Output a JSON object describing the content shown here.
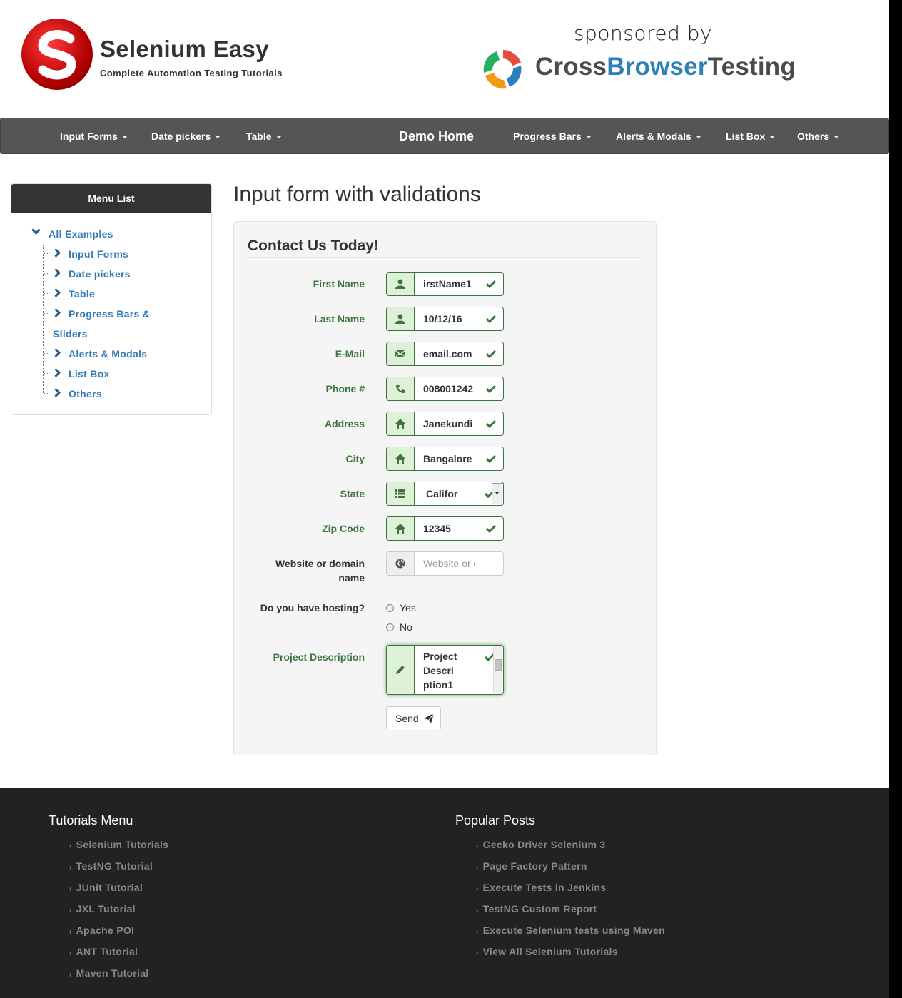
{
  "header": {
    "brand_title": "Selenium Easy",
    "brand_subtitle": "Complete Automation Testing Tutorials",
    "sponsor_text": "sponsored by",
    "sponsor_name_part1": "Cross",
    "sponsor_name_part2": "Browser",
    "sponsor_name_part3": "Testing"
  },
  "nav": {
    "items": [
      {
        "label": "Input Forms"
      },
      {
        "label": "Date pickers"
      },
      {
        "label": "Table"
      },
      {
        "label": "Demo Home"
      },
      {
        "label": "Progress Bars"
      },
      {
        "label": "Alerts & Modals"
      },
      {
        "label": "List Box"
      },
      {
        "label": "Others"
      }
    ]
  },
  "sidebar": {
    "title": "Menu List",
    "root": "All Examples",
    "items": [
      {
        "label": "Input Forms"
      },
      {
        "label": "Date pickers"
      },
      {
        "label": "Table"
      },
      {
        "label": "Progress Bars &"
      },
      {
        "label": "Sliders"
      },
      {
        "label": "Alerts & Modals"
      },
      {
        "label": "List Box"
      },
      {
        "label": "Others"
      }
    ]
  },
  "main": {
    "title": "Input form with validations",
    "legend": "Contact Us Today!",
    "fields": {
      "first_name": {
        "label": "First Name",
        "value": "irstName1"
      },
      "last_name": {
        "label": "Last Name",
        "value": "10/12/16"
      },
      "email": {
        "label": "E-Mail",
        "value": "email.com"
      },
      "phone": {
        "label": "Phone #",
        "value": "008001242"
      },
      "address": {
        "label": "Address",
        "value": "Janekundi"
      },
      "city": {
        "label": "City",
        "value": "Bangalore"
      },
      "state": {
        "label": "State",
        "value": "Califor"
      },
      "zip": {
        "label": "Zip Code",
        "value": "12345"
      },
      "website": {
        "label_line1": "Website or domain",
        "label_line2": "name",
        "placeholder": "Website or doi"
      },
      "hosting": {
        "label": "Do you have hosting?",
        "option_yes": "Yes",
        "option_no": "No"
      },
      "project": {
        "label": "Project Description",
        "line1": "Project",
        "line2": "Descri",
        "line3": "ption1"
      }
    },
    "send_label": "Send"
  },
  "footer": {
    "tutorials_heading": "Tutorials Menu",
    "tutorials": [
      "Selenium Tutorials",
      "TestNG Tutorial",
      "JUnit Tutorial",
      "JXL Tutorial",
      "Apache POI",
      "ANT Tutorial",
      "Maven Tutorial"
    ],
    "popular_heading": "Popular Posts",
    "popular": [
      "Gecko Driver Selenium 3",
      "Page Factory Pattern",
      "Execute Tests in Jenkins",
      "TestNG Custom Report",
      "Execute Selenium tests using Maven",
      "View All Selenium Tutorials"
    ]
  },
  "colors": {
    "nav_bg": "#555555",
    "success_green": "#3c763d",
    "link_blue": "#337ab7",
    "footer_bg": "#222222"
  }
}
